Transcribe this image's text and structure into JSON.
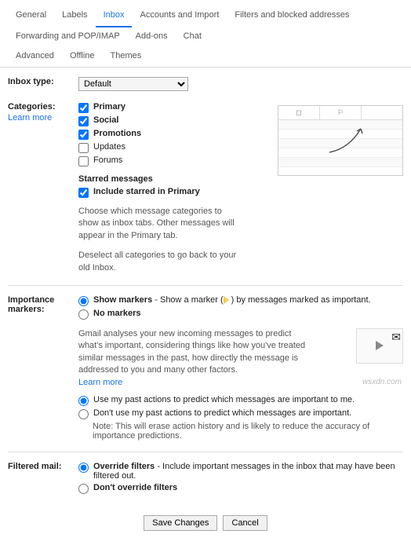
{
  "tabs": {
    "row1": [
      "General",
      "Labels",
      "Inbox",
      "Accounts and Import",
      "Filters and blocked addresses",
      "Forwarding and POP/IMAP",
      "Add-ons",
      "Chat"
    ],
    "row2": [
      "Advanced",
      "Offline",
      "Themes"
    ],
    "active": "Inbox"
  },
  "inbox_type": {
    "label": "Inbox type:",
    "value": "Default"
  },
  "categories": {
    "label": "Categories:",
    "learn_more": "Learn more",
    "items": [
      {
        "label": "Primary",
        "checked": true,
        "bold": true
      },
      {
        "label": "Social",
        "checked": true,
        "bold": true
      },
      {
        "label": "Promotions",
        "checked": true,
        "bold": true
      },
      {
        "label": "Updates",
        "checked": false,
        "bold": false
      },
      {
        "label": "Forums",
        "checked": false,
        "bold": false
      }
    ],
    "starred_head": "Starred messages",
    "starred_label": "Include starred in Primary",
    "starred_checked": true,
    "desc1": "Choose which message categories to show as inbox tabs. Other messages will appear in the Primary tab.",
    "desc2": "Deselect all categories to go back to your old Inbox."
  },
  "importance": {
    "label": "Importance markers:",
    "show_markers": "Show markers",
    "show_markers_suffix_a": " - Show a marker (",
    "show_markers_suffix_b": ") by messages marked as important.",
    "no_markers": "No markers",
    "analysis": "Gmail analyses your new incoming messages to predict what's important, considering things like how you've treated similar messages in the past, how directly the message is addressed to you and many other factors.",
    "learn_more": "Learn more",
    "use_past": "Use my past actions to predict which messages are important to me.",
    "dont_use_past": "Don't use my past actions to predict which messages are important.",
    "note": "Note: This will erase action history and is likely to reduce the accuracy of importance predictions."
  },
  "filtered": {
    "label": "Filtered mail:",
    "override": "Override filters",
    "override_suffix": " - Include important messages in the inbox that may have been filtered out.",
    "dont_override": "Don't override filters"
  },
  "buttons": {
    "save": "Save Changes",
    "cancel": "Cancel"
  },
  "watermark": "wsxdn.com"
}
